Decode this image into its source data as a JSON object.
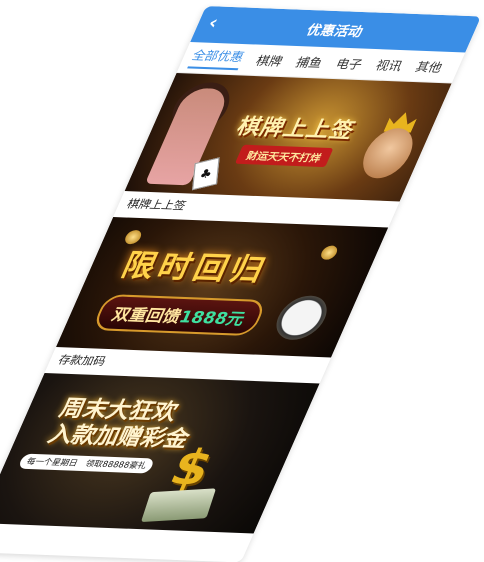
{
  "header": {
    "title": "优惠活动",
    "back_icon": "chevron-left-icon"
  },
  "tabs": [
    {
      "label": "全部优惠",
      "active": true
    },
    {
      "label": "棋牌"
    },
    {
      "label": "捕鱼"
    },
    {
      "label": "电子"
    },
    {
      "label": "视讯"
    },
    {
      "label": "其他"
    }
  ],
  "promos": [
    {
      "banner_title": "棋牌上上签",
      "banner_sub": "财运天天不打烊",
      "caption": "棋牌上上签"
    },
    {
      "banner_title": "限时回归",
      "banner_pill_text": "双重回馈",
      "banner_pill_amount": "1888元",
      "caption": "存款加码"
    },
    {
      "banner_title_line1": "周末大狂欢",
      "banner_title_line2": "入款加赠彩金",
      "banner_tag": "每一个星期日　领取88888豪礼"
    }
  ],
  "colors": {
    "accent": "#3a8ee6"
  }
}
